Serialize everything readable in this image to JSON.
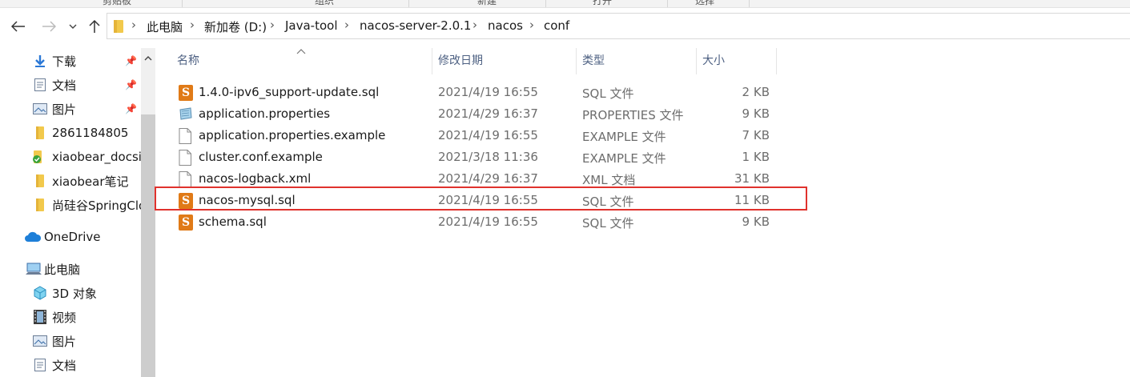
{
  "ribbon": {
    "groups": [
      "剪贴板",
      "组织",
      "新建",
      "打开",
      "选择"
    ]
  },
  "nav": {
    "back_icon": "arrow-left-icon",
    "forward_icon": "arrow-right-icon",
    "recent_icon": "chevron-down-icon",
    "up_icon": "arrow-up-icon"
  },
  "address": {
    "crumbs": [
      "此电脑",
      "新加卷 (D:)",
      "Java-tool",
      "nacos-server-2.0.1",
      "nacos",
      "conf"
    ]
  },
  "sidebar": {
    "items": [
      {
        "label": "下载",
        "icon": "download-arrow-icon",
        "pinned": true
      },
      {
        "label": "文档",
        "icon": "document-icon",
        "pinned": true
      },
      {
        "label": "图片",
        "icon": "pictures-icon",
        "pinned": true
      },
      {
        "label": "2861184805",
        "icon": "folder-icon",
        "pinned": false
      },
      {
        "label": "xiaobear_docsi",
        "icon": "synced-folder-icon",
        "pinned": false
      },
      {
        "label": "xiaobear笔记",
        "icon": "folder-icon",
        "pinned": false
      },
      {
        "label": "尚硅谷SpringClo",
        "icon": "folder-icon",
        "pinned": false
      },
      {
        "label": "OneDrive",
        "icon": "cloud-icon",
        "pinned": false
      },
      {
        "label": "此电脑",
        "icon": "computer-icon",
        "pinned": false
      },
      {
        "label": "3D 对象",
        "icon": "cube-3d-icon",
        "pinned": false
      },
      {
        "label": "视频",
        "icon": "film-icon",
        "pinned": false
      },
      {
        "label": "图片",
        "icon": "pictures-icon",
        "pinned": false
      },
      {
        "label": "文档",
        "icon": "document-icon",
        "pinned": false
      }
    ]
  },
  "columns": {
    "name": "名称",
    "date": "修改日期",
    "type": "类型",
    "size": "大小"
  },
  "files": [
    {
      "name": "1.4.0-ipv6_support-update.sql",
      "date": "2021/4/19 16:55",
      "type": "SQL 文件",
      "size": "2 KB",
      "icon": "sql-file-icon"
    },
    {
      "name": "application.properties",
      "date": "2021/4/29 16:37",
      "type": "PROPERTIES 文件",
      "size": "9 KB",
      "icon": "properties-file-icon"
    },
    {
      "name": "application.properties.example",
      "date": "2021/4/19 16:55",
      "type": "EXAMPLE 文件",
      "size": "7 KB",
      "icon": "blank-file-icon"
    },
    {
      "name": "cluster.conf.example",
      "date": "2021/3/18 11:36",
      "type": "EXAMPLE 文件",
      "size": "1 KB",
      "icon": "blank-file-icon"
    },
    {
      "name": "nacos-logback.xml",
      "date": "2021/4/29 16:37",
      "type": "XML 文档",
      "size": "31 KB",
      "icon": "blank-file-icon"
    },
    {
      "name": "nacos-mysql.sql",
      "date": "2021/4/19 16:55",
      "type": "SQL 文件",
      "size": "11 KB",
      "icon": "sql-file-icon",
      "highlighted": true
    },
    {
      "name": "schema.sql",
      "date": "2021/4/19 16:55",
      "type": "SQL 文件",
      "size": "9 KB",
      "icon": "sql-file-icon"
    }
  ],
  "colors": {
    "highlight_border": "#e0322d",
    "header_text": "#4d6082",
    "sql_icon": "#e07a17"
  }
}
